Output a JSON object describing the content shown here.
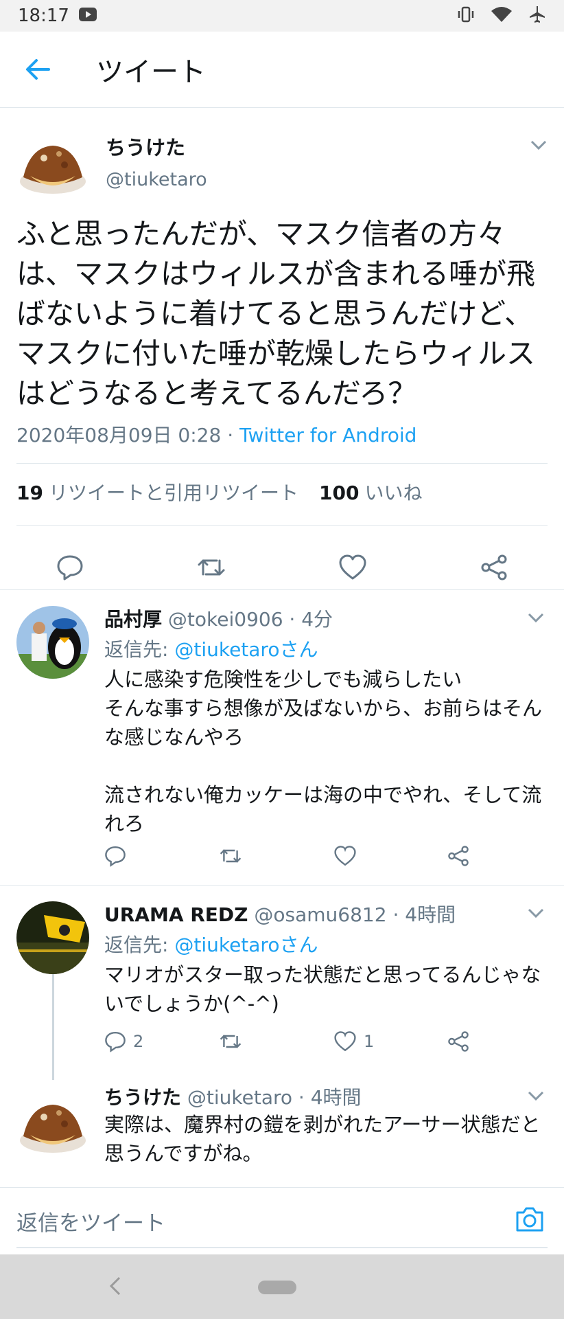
{
  "status_bar": {
    "time": "18:17",
    "icons": [
      "youtube-icon",
      "vibrate-icon",
      "wifi-icon",
      "airplane-icon"
    ]
  },
  "header": {
    "title": "ツイート",
    "back_icon": "arrow-left-icon"
  },
  "main_tweet": {
    "name": "ちうけた",
    "handle": "@tiuketaro",
    "text": "ふと思ったんだが、マスク信者の方々は、マスクはウィルスが含まれる唾が飛ばないように着けてると思うんだけど、マスクに付いた唾が乾燥したらウィルスはどうなると考えてるんだろ？",
    "datetime": "2020年08月09日 0:28",
    "separator": " · ",
    "source": "Twitter for Android",
    "retweets_count": "19",
    "retweets_label": "リツイートと引用リツイート",
    "likes_count": "100",
    "likes_label": "いいね"
  },
  "replies": [
    {
      "name": "品村厚",
      "handle_time": "@tokei0906 · 4分",
      "reply_to_label": "返信先: ",
      "reply_to_mention": "@tiuketaroさん",
      "text": "人に感染す危険性を少しでも減らしたい\nそんな事すら想像が及ばないから、お前らはそんな感じなんやろ\n\n流されない俺カッケーは海の中でやれ、そして流れろ",
      "reply_count": "",
      "like_count": ""
    },
    {
      "name": "URAMA REDZ",
      "handle_time": "@osamu6812 · 4時間",
      "reply_to_label": "返信先: ",
      "reply_to_mention": "@tiuketaroさん",
      "text": "マリオがスター取った状態だと思ってるんじゃないでしょうか(^-^)",
      "reply_count": "2",
      "like_count": "1"
    },
    {
      "name": "ちうけた",
      "handle_time": "@tiuketaro · 4時間",
      "text": "実際は、魔界村の鎧を剥がれたアーサー状態だと思うんですがね。"
    }
  ],
  "compose": {
    "placeholder": "返信をツイート",
    "camera_icon": "camera-icon"
  },
  "colors": {
    "accent": "#1da1f2",
    "secondary_text": "#657786",
    "divider": "#e1e8ed"
  }
}
